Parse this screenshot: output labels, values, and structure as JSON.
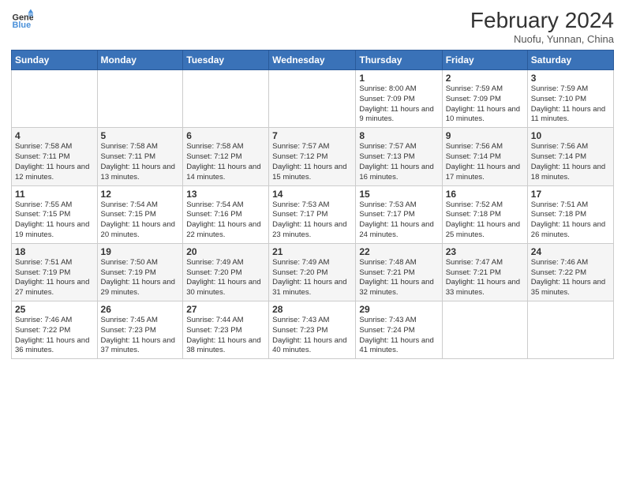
{
  "logo": {
    "line1": "General",
    "line2": "Blue"
  },
  "title": {
    "month_year": "February 2024",
    "location": "Nuofu, Yunnan, China"
  },
  "weekdays": [
    "Sunday",
    "Monday",
    "Tuesday",
    "Wednesday",
    "Thursday",
    "Friday",
    "Saturday"
  ],
  "weeks": [
    [
      {
        "day": "",
        "info": ""
      },
      {
        "day": "",
        "info": ""
      },
      {
        "day": "",
        "info": ""
      },
      {
        "day": "",
        "info": ""
      },
      {
        "day": "1",
        "info": "Sunrise: 8:00 AM\nSunset: 7:09 PM\nDaylight: 11 hours\nand 9 minutes."
      },
      {
        "day": "2",
        "info": "Sunrise: 7:59 AM\nSunset: 7:09 PM\nDaylight: 11 hours\nand 10 minutes."
      },
      {
        "day": "3",
        "info": "Sunrise: 7:59 AM\nSunset: 7:10 PM\nDaylight: 11 hours\nand 11 minutes."
      }
    ],
    [
      {
        "day": "4",
        "info": "Sunrise: 7:58 AM\nSunset: 7:11 PM\nDaylight: 11 hours\nand 12 minutes."
      },
      {
        "day": "5",
        "info": "Sunrise: 7:58 AM\nSunset: 7:11 PM\nDaylight: 11 hours\nand 13 minutes."
      },
      {
        "day": "6",
        "info": "Sunrise: 7:58 AM\nSunset: 7:12 PM\nDaylight: 11 hours\nand 14 minutes."
      },
      {
        "day": "7",
        "info": "Sunrise: 7:57 AM\nSunset: 7:12 PM\nDaylight: 11 hours\nand 15 minutes."
      },
      {
        "day": "8",
        "info": "Sunrise: 7:57 AM\nSunset: 7:13 PM\nDaylight: 11 hours\nand 16 minutes."
      },
      {
        "day": "9",
        "info": "Sunrise: 7:56 AM\nSunset: 7:14 PM\nDaylight: 11 hours\nand 17 minutes."
      },
      {
        "day": "10",
        "info": "Sunrise: 7:56 AM\nSunset: 7:14 PM\nDaylight: 11 hours\nand 18 minutes."
      }
    ],
    [
      {
        "day": "11",
        "info": "Sunrise: 7:55 AM\nSunset: 7:15 PM\nDaylight: 11 hours\nand 19 minutes."
      },
      {
        "day": "12",
        "info": "Sunrise: 7:54 AM\nSunset: 7:15 PM\nDaylight: 11 hours\nand 20 minutes."
      },
      {
        "day": "13",
        "info": "Sunrise: 7:54 AM\nSunset: 7:16 PM\nDaylight: 11 hours\nand 22 minutes."
      },
      {
        "day": "14",
        "info": "Sunrise: 7:53 AM\nSunset: 7:17 PM\nDaylight: 11 hours\nand 23 minutes."
      },
      {
        "day": "15",
        "info": "Sunrise: 7:53 AM\nSunset: 7:17 PM\nDaylight: 11 hours\nand 24 minutes."
      },
      {
        "day": "16",
        "info": "Sunrise: 7:52 AM\nSunset: 7:18 PM\nDaylight: 11 hours\nand 25 minutes."
      },
      {
        "day": "17",
        "info": "Sunrise: 7:51 AM\nSunset: 7:18 PM\nDaylight: 11 hours\nand 26 minutes."
      }
    ],
    [
      {
        "day": "18",
        "info": "Sunrise: 7:51 AM\nSunset: 7:19 PM\nDaylight: 11 hours\nand 27 minutes."
      },
      {
        "day": "19",
        "info": "Sunrise: 7:50 AM\nSunset: 7:19 PM\nDaylight: 11 hours\nand 29 minutes."
      },
      {
        "day": "20",
        "info": "Sunrise: 7:49 AM\nSunset: 7:20 PM\nDaylight: 11 hours\nand 30 minutes."
      },
      {
        "day": "21",
        "info": "Sunrise: 7:49 AM\nSunset: 7:20 PM\nDaylight: 11 hours\nand 31 minutes."
      },
      {
        "day": "22",
        "info": "Sunrise: 7:48 AM\nSunset: 7:21 PM\nDaylight: 11 hours\nand 32 minutes."
      },
      {
        "day": "23",
        "info": "Sunrise: 7:47 AM\nSunset: 7:21 PM\nDaylight: 11 hours\nand 33 minutes."
      },
      {
        "day": "24",
        "info": "Sunrise: 7:46 AM\nSunset: 7:22 PM\nDaylight: 11 hours\nand 35 minutes."
      }
    ],
    [
      {
        "day": "25",
        "info": "Sunrise: 7:46 AM\nSunset: 7:22 PM\nDaylight: 11 hours\nand 36 minutes."
      },
      {
        "day": "26",
        "info": "Sunrise: 7:45 AM\nSunset: 7:23 PM\nDaylight: 11 hours\nand 37 minutes."
      },
      {
        "day": "27",
        "info": "Sunrise: 7:44 AM\nSunset: 7:23 PM\nDaylight: 11 hours\nand 38 minutes."
      },
      {
        "day": "28",
        "info": "Sunrise: 7:43 AM\nSunset: 7:23 PM\nDaylight: 11 hours\nand 40 minutes."
      },
      {
        "day": "29",
        "info": "Sunrise: 7:43 AM\nSunset: 7:24 PM\nDaylight: 11 hours\nand 41 minutes."
      },
      {
        "day": "",
        "info": ""
      },
      {
        "day": "",
        "info": ""
      }
    ]
  ]
}
